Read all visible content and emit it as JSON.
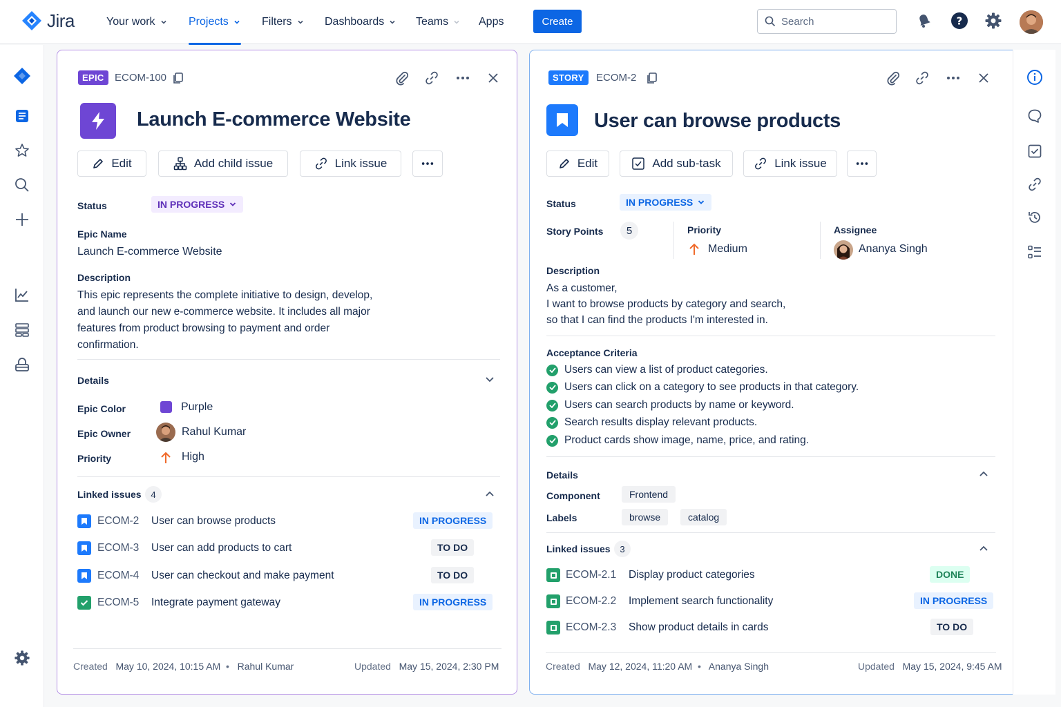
{
  "app": {
    "name": "Jira"
  },
  "nav": {
    "your_work": "Your work",
    "projects": "Projects",
    "filters": "Filters",
    "dashboards": "Dashboards",
    "teams": "Teams",
    "apps": "Apps",
    "create": "Create",
    "search_placeholder": "Search"
  },
  "epic": {
    "type": "EPIC",
    "key": "ECOM-100",
    "title": "Launch E-commerce Website",
    "actions": {
      "edit": "Edit",
      "add_child": "Add child issue",
      "link": "Link issue"
    },
    "status_label": "Status",
    "status": "IN PROGRESS",
    "epic_name_label": "Epic Name",
    "epic_name": "Launch E-commerce Website",
    "description_label": "Description",
    "description_lines": [
      "This epic represents the complete initiative to design, develop,",
      "and launch our new e-commerce website. It includes all major",
      "features from product browsing to payment and order",
      "confirmation."
    ],
    "details_label": "Details",
    "epic_color_label": "Epic Color",
    "epic_color": "Purple",
    "epic_color_hex": "#6e46d4",
    "epic_owner_label": "Epic Owner",
    "epic_owner": "Rahul Kumar",
    "priority_label": "Priority",
    "priority": "High",
    "linked_label": "Linked issues",
    "linked_count": "4",
    "linked": [
      {
        "key": "ECOM-2",
        "summary": "User can browse products",
        "status": "IN PROGRESS",
        "type": "story"
      },
      {
        "key": "ECOM-3",
        "summary": "User can add products to cart",
        "status": "TO DO",
        "type": "story"
      },
      {
        "key": "ECOM-4",
        "summary": "User can checkout and make payment",
        "status": "TO DO",
        "type": "story"
      },
      {
        "key": "ECOM-5",
        "summary": "Integrate payment gateway",
        "status": "IN PROGRESS",
        "type": "task"
      }
    ],
    "footer": {
      "created_label": "Created",
      "created": "May 10, 2024, 10:15 AM",
      "creator": "Rahul Kumar",
      "updated_label": "Updated",
      "updated": "May 15, 2024, 2:30 PM"
    }
  },
  "story": {
    "type": "STORY",
    "key": "ECOM-2",
    "title": "User can browse products",
    "actions": {
      "edit": "Edit",
      "add_subtask": "Add sub-task",
      "link": "Link issue"
    },
    "status_label": "Status",
    "status": "IN PROGRESS",
    "story_points_label": "Story Points",
    "story_points": "5",
    "priority_label": "Priority",
    "priority": "Medium",
    "assignee_label": "Assignee",
    "assignee": "Ananya Singh",
    "description_label": "Description",
    "description_lines": [
      "As a customer,",
      "I want to browse products by category and search,",
      "so that I can find the products I'm interested in."
    ],
    "ac_label": "Acceptance Criteria",
    "acceptance_criteria": [
      "Users can view a list of product categories.",
      "Users can click on a category to see products in that category.",
      "Users can search products by name or keyword.",
      "Search results display relevant products.",
      "Product cards show image, name, price, and rating."
    ],
    "details_label": "Details",
    "component_label": "Component",
    "component": "Frontend",
    "labels_label": "Labels",
    "labels": [
      "browse",
      "catalog"
    ],
    "linked_label": "Linked issues",
    "linked_count": "3",
    "linked": [
      {
        "key": "ECOM-2.1",
        "summary": "Display product categories",
        "status": "DONE"
      },
      {
        "key": "ECOM-2.2",
        "summary": "Implement search functionality",
        "status": "IN PROGRESS"
      },
      {
        "key": "ECOM-2.3",
        "summary": "Show product details in cards",
        "status": "TO DO"
      }
    ],
    "footer": {
      "created_label": "Created",
      "created": "May 12, 2024, 11:20 AM",
      "creator": "Ananya Singh",
      "updated_label": "Updated",
      "updated": "May 15, 2024, 9:45 AM"
    }
  },
  "colors": {
    "accent": "#0c66e4",
    "epic": "#6e46d4",
    "story": "#1d7afc",
    "task": "#22a06b",
    "priority_up": "#f06a2b"
  },
  "icons": {
    "top": [
      "notification-icon",
      "help-icon",
      "settings-icon"
    ],
    "left": [
      "project-icon",
      "backlog-icon",
      "star-icon",
      "search-icon",
      "plus-icon",
      "reports-icon",
      "components-icon",
      "archive-icon",
      "settings-icon"
    ],
    "right": [
      "info-icon",
      "comment-icon",
      "checklist-icon",
      "link-icon",
      "history-icon",
      "list-icon"
    ]
  }
}
